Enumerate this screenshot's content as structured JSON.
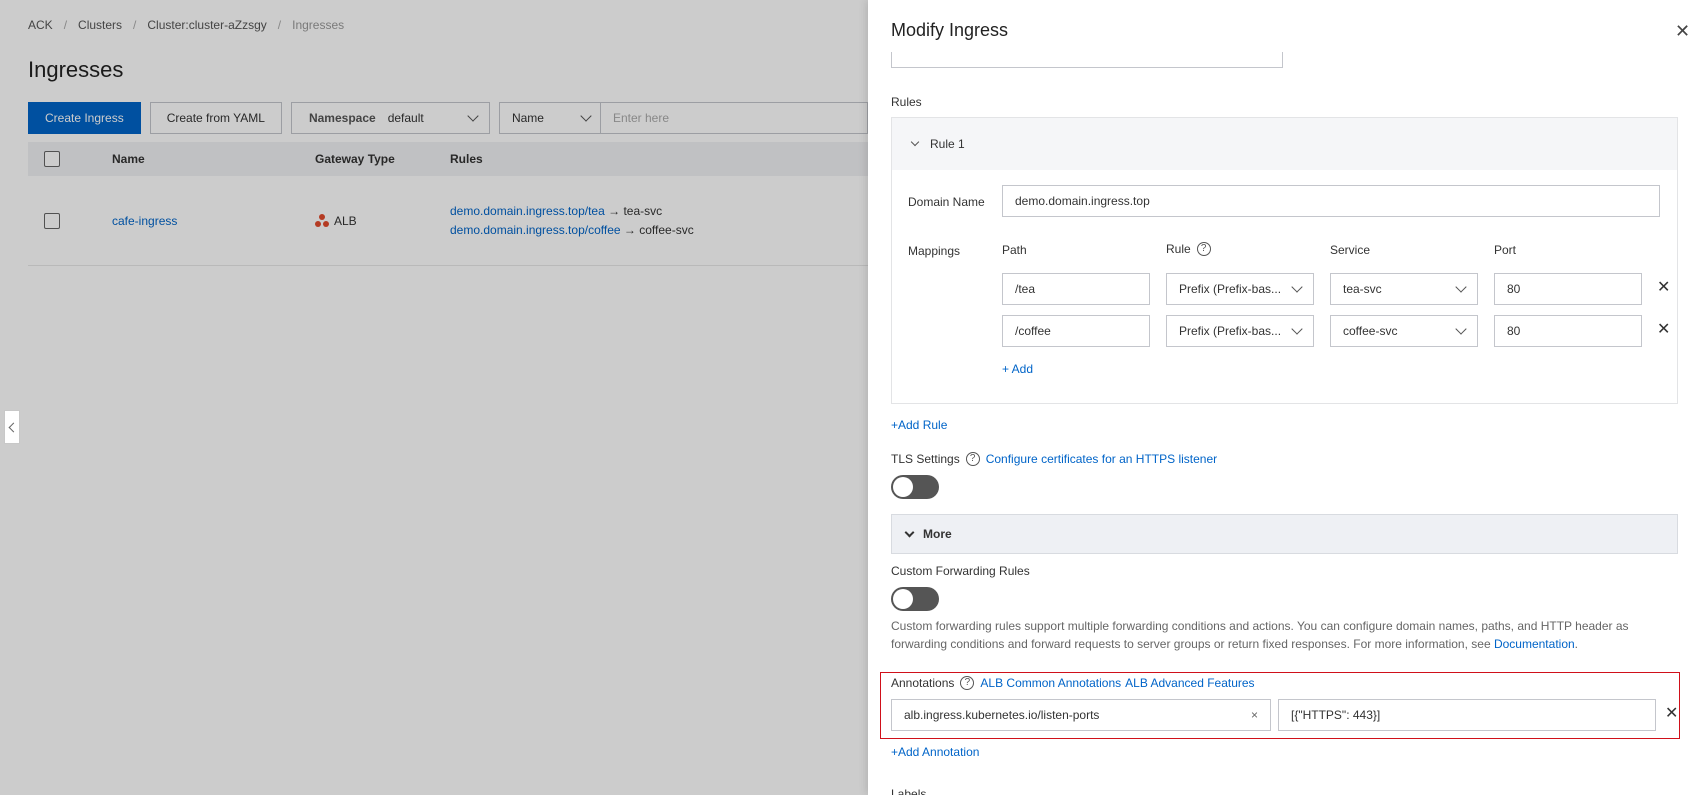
{
  "breadcrumb": [
    "ACK",
    "Clusters",
    "Cluster:cluster-aZzsgy",
    "Ingresses"
  ],
  "page_title": "Ingresses",
  "toolbar": {
    "create_ingress": "Create Ingress",
    "create_from_yaml": "Create from YAML",
    "namespace_label": "Namespace",
    "namespace_value": "default",
    "filter_field": "Name",
    "search_placeholder": "Enter here"
  },
  "table": {
    "columns": [
      "Name",
      "Gateway Type",
      "Rules"
    ],
    "rows": [
      {
        "name": "cafe-ingress",
        "gateway_type": "ALB",
        "rules": [
          {
            "path": "demo.domain.ingress.top/tea",
            "arrow": "→",
            "service": "tea-svc"
          },
          {
            "path": "demo.domain.ingress.top/coffee",
            "arrow": "→",
            "service": "coffee-svc"
          }
        ]
      }
    ]
  },
  "drawer": {
    "title": "Modify Ingress",
    "close": "✕",
    "rules_label": "Rules",
    "rule_title": "Rule 1",
    "domain_label": "Domain Name",
    "domain_value": "demo.domain.ingress.top",
    "mappings_label": "Mappings",
    "mapping_columns": {
      "path": "Path",
      "rule": "Rule",
      "service": "Service",
      "port": "Port"
    },
    "help_glyph": "?",
    "remove_glyph": "✕",
    "mappings": [
      {
        "path": "/tea",
        "rule": "Prefix (Prefix-bas...",
        "service": "tea-svc",
        "port": "80"
      },
      {
        "path": "/coffee",
        "rule": "Prefix (Prefix-bas...",
        "service": "coffee-svc",
        "port": "80"
      }
    ],
    "add_mapping": "+ Add",
    "add_rule": "+Add Rule",
    "tls_label": "TLS Settings",
    "tls_link": "Configure certificates for an HTTPS listener",
    "tls_enabled": false,
    "more_label": "More",
    "custom_forwarding_label": "Custom Forwarding Rules",
    "custom_forwarding_enabled": false,
    "custom_forwarding_desc": "Custom forwarding rules support multiple forwarding conditions and actions. You can configure domain names, paths, and HTTP header as forwarding conditions and forward requests to server groups or return fixed responses. For more information, see ",
    "doc_link": "Documentation",
    "doc_suffix": ".",
    "annotations_label": "Annotations",
    "annotations_link1": "ALB Common Annotations",
    "annotations_link2": "ALB Advanced Features",
    "annotation_key": "alb.ingress.kubernetes.io/listen-ports",
    "annotation_clear": "×",
    "annotation_value": "[{\"HTTPS\": 443}]",
    "add_annotation": "+Add Annotation",
    "labels_label": "Labels"
  },
  "colors": {
    "primary": "#0064c8",
    "highlight_border": "#d0101a",
    "alb_icon": "#e24a2c"
  }
}
